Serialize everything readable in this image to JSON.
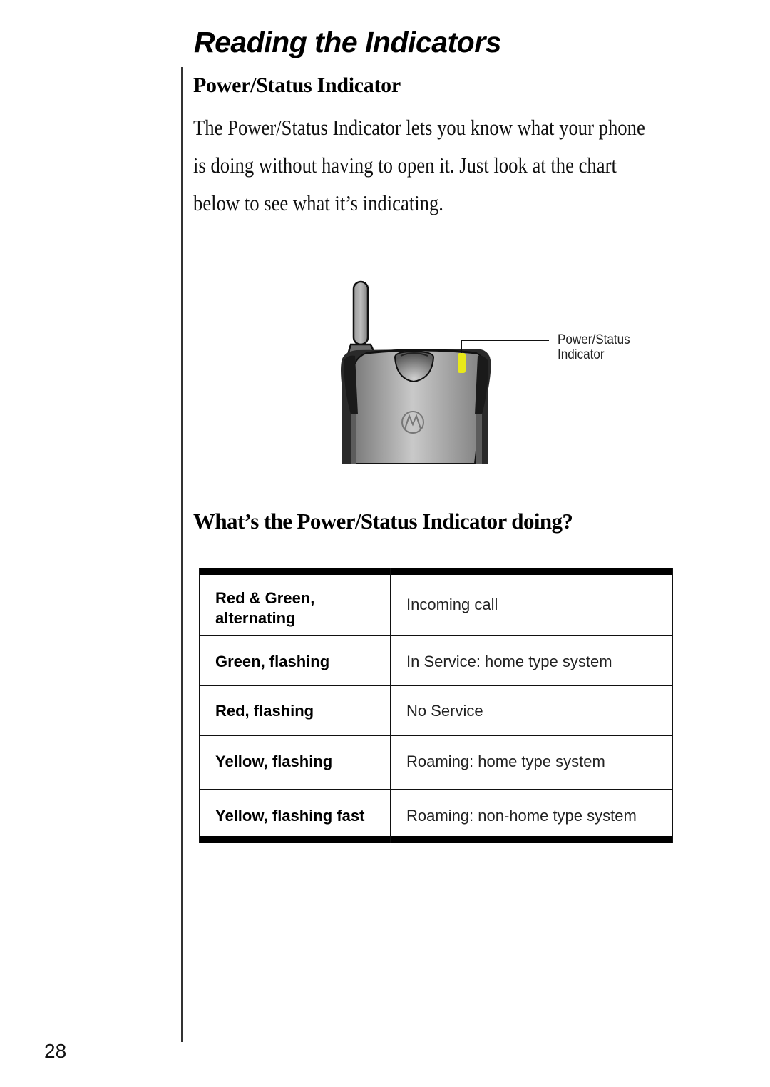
{
  "page": {
    "title": "Reading the Indicators",
    "section_heading": "Power/Status Indicator",
    "intro_lines": [
      "The Power/Status Indicator lets you know what your phone",
      "is doing without having to open it. Just look at the chart",
      "below to see what it’s indicating."
    ],
    "figure": {
      "callout_lines": [
        "Power/Status",
        "Indicator"
      ],
      "indicator_color": "#e8e81a",
      "logo_icon": "motorola-logo-icon"
    },
    "table_heading": "What’s the Power/Status Indicator doing?",
    "table": {
      "rows": [
        {
          "indicator": [
            "Red & Green,",
            "alternating"
          ],
          "meaning": "Incoming call"
        },
        {
          "indicator": [
            "Green, flashing"
          ],
          "meaning": "In Service: home type system"
        },
        {
          "indicator": [
            "Red, flashing"
          ],
          "meaning": "No Service"
        },
        {
          "indicator": [
            "Yellow, flashing"
          ],
          "meaning": "Roaming: home type system"
        },
        {
          "indicator": [
            "Yellow, flashing fast"
          ],
          "meaning": "Roaming: non-home type system"
        }
      ]
    },
    "page_number": "28"
  }
}
